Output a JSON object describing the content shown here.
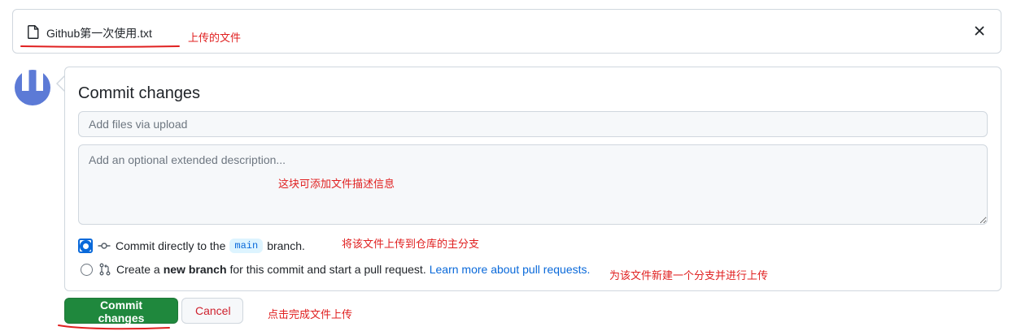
{
  "file": {
    "name": "Github第一次使用.txt"
  },
  "commit": {
    "title": "Commit changes",
    "summary_placeholder": "Add files via upload",
    "description_placeholder": "Add an optional extended description...",
    "option_direct": {
      "prefix": "Commit directly to the",
      "branch": "main",
      "suffix": "branch."
    },
    "option_new": {
      "prefix": "Create a",
      "bold": "new branch",
      "suffix": "for this commit and start a pull request.",
      "link": "Learn more about pull requests."
    },
    "selected_option": "direct"
  },
  "buttons": {
    "commit": "Commit changes",
    "cancel": "Cancel"
  },
  "annotations": {
    "uploaded_file": "上传的文件",
    "description_hint": "这块可添加文件描述信息",
    "direct_hint": "将该文件上传到仓库的主分支",
    "new_branch_hint": "为该文件新建一个分支并进行上传",
    "commit_hint": "点击完成文件上传"
  },
  "colors": {
    "annotation": "#e02020",
    "primary_button": "#1f883d",
    "cancel_text": "#cf222e",
    "link": "#0969da",
    "avatar": "#5c7ad6"
  }
}
